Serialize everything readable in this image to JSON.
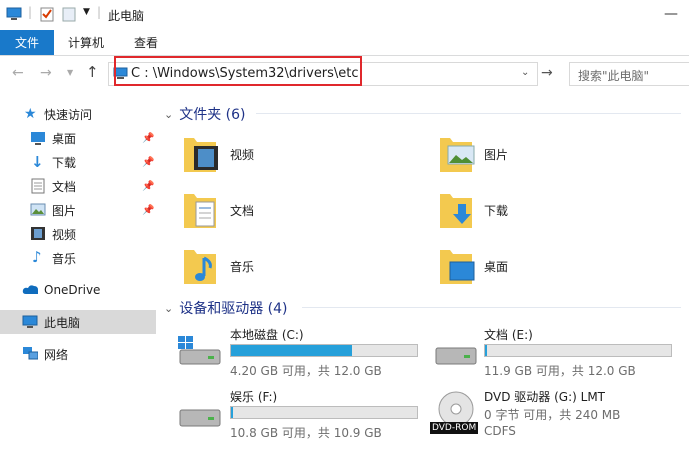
{
  "window": {
    "title": "此电脑"
  },
  "ribbon": {
    "tabs": [
      "文件",
      "计算机",
      "查看"
    ]
  },
  "address": {
    "path": "C : \\Windows\\System32\\drivers\\etc"
  },
  "search": {
    "placeholder": "搜索\"此电脑\""
  },
  "sidebar": {
    "items": [
      {
        "label": "快速访问",
        "icon": "star-icon"
      },
      {
        "label": "桌面",
        "icon": "desktop-icon",
        "pinned": true
      },
      {
        "label": "下载",
        "icon": "download-icon",
        "pinned": true
      },
      {
        "label": "文档",
        "icon": "document-icon",
        "pinned": true
      },
      {
        "label": "图片",
        "icon": "picture-icon",
        "pinned": true
      },
      {
        "label": "视频",
        "icon": "video-icon"
      },
      {
        "label": "音乐",
        "icon": "music-icon"
      },
      {
        "label": "OneDrive",
        "icon": "cloud-icon"
      },
      {
        "label": "此电脑",
        "icon": "computer-icon",
        "selected": true
      },
      {
        "label": "网络",
        "icon": "network-icon"
      }
    ]
  },
  "folders_section": {
    "title": "文件夹 (6)"
  },
  "folders": [
    "视频",
    "图片",
    "文档",
    "下载",
    "音乐",
    "桌面"
  ],
  "drives_section": {
    "title": "设备和驱动器 (4)"
  },
  "drives": [
    {
      "name": "本地磁盘 (C:)",
      "sub": "4.20 GB 可用，共 12.0 GB",
      "used": 0.65
    },
    {
      "name": "文档 (E:)",
      "sub": "11.9 GB 可用，共 12.0 GB",
      "used": 0.01
    },
    {
      "name": "娱乐 (F:)",
      "sub": "10.8 GB 可用，共 10.9 GB",
      "used": 0.01
    },
    {
      "name": "DVD 驱动器 (G:) LMT",
      "sub": "0 字节 可用，共 240 MB",
      "sub2": "CDFS",
      "badge": "DVD-ROM"
    }
  ],
  "colors": {
    "accent": "#1979ca",
    "bar": "#26a0da",
    "folder": "#f3c94f",
    "highlight": "#e0282c"
  }
}
